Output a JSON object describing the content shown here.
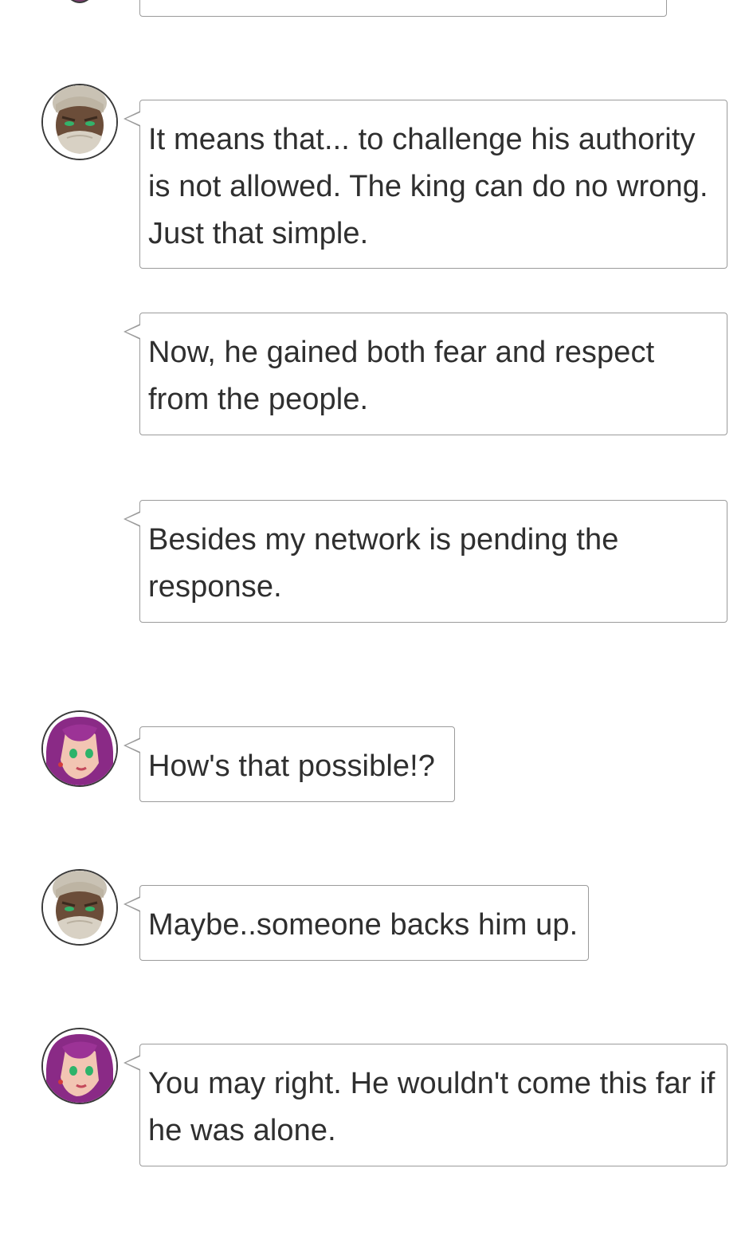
{
  "chat": {
    "messages": [
      {
        "speaker": "old-man",
        "text": "It means that... to challenge his authority is not allowed. The king can do no wrong. Just that simple."
      },
      {
        "speaker": "old-man",
        "text": "Now, he gained both fear and respect from the people."
      },
      {
        "speaker": "old-man",
        "text": "Besides my network is pending the response."
      },
      {
        "speaker": "purple-haired-woman",
        "text": "How's that possible!?"
      },
      {
        "speaker": "old-man",
        "text": "Maybe..someone backs him up."
      },
      {
        "speaker": "purple-haired-woman",
        "text": "You may right. He wouldn't come this far if he was alone."
      }
    ]
  },
  "colors": {
    "bubble_border": "#9b9b9b",
    "text": "#2f2f2f",
    "background": "#ffffff",
    "hair_purple": "#8a2a86"
  },
  "icons": {
    "old_man_avatar": "old-man-avatar",
    "woman_avatar": "purple-haired-woman-avatar"
  }
}
